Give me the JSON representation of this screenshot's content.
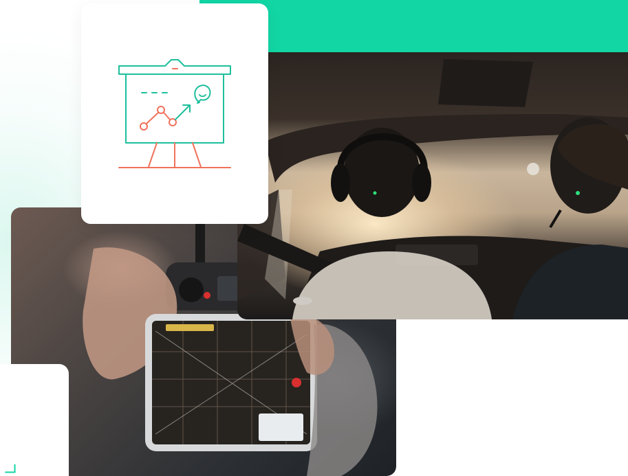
{
  "colors": {
    "brand_teal": "#12d6a4",
    "icon_teal": "#1dbf9c",
    "icon_coral": "#f0715a"
  },
  "icons": {
    "presentation": "presentation-board-icon",
    "chevron": "chevron-right-icon"
  },
  "images": {
    "drone_controller": "photo-drone-controller",
    "cockpit": "photo-cockpit-pilots"
  }
}
